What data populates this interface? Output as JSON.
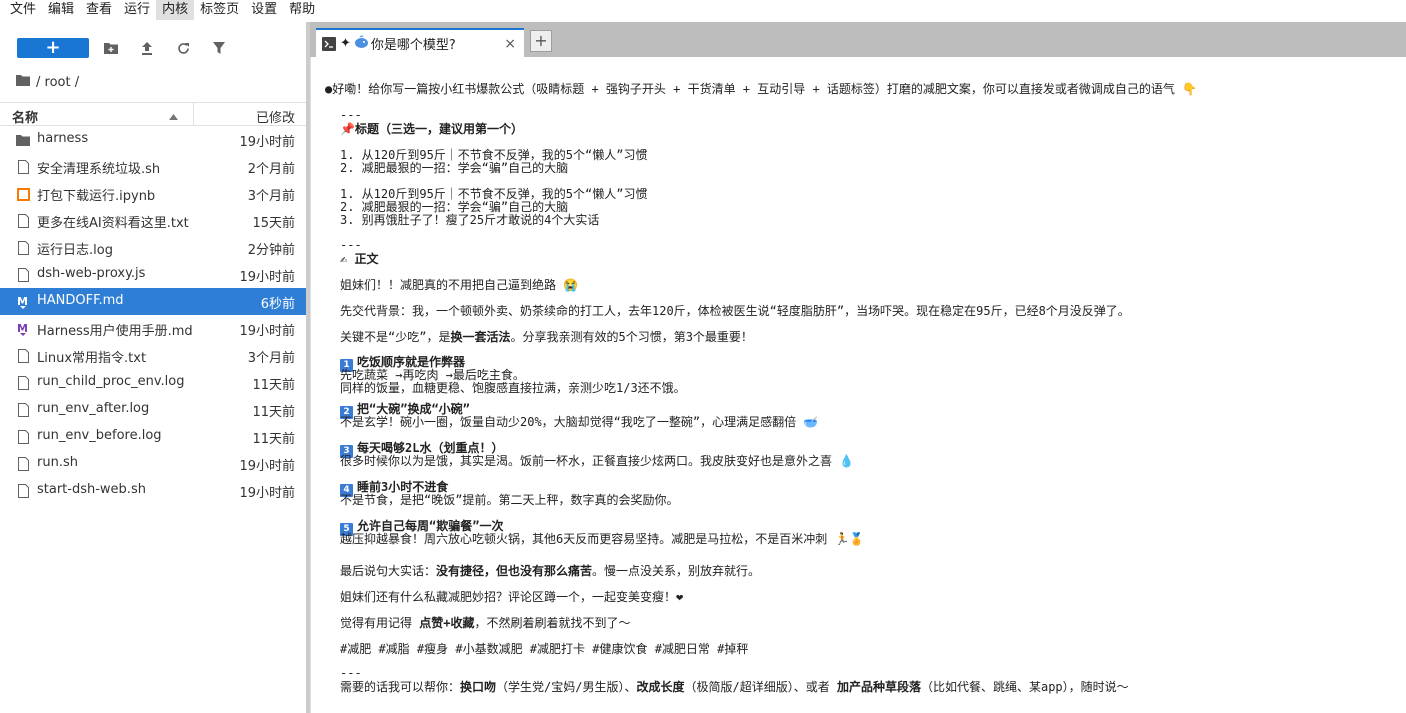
{
  "menu": [
    "文件",
    "编辑",
    "查看",
    "运行",
    "内核",
    "标签页",
    "设置",
    "帮助"
  ],
  "menu_active_index": 4,
  "filebrowser": {
    "new_label": "+",
    "breadcrumb": "/ root /",
    "col_name": "名称",
    "col_modified": "已修改",
    "files": [
      {
        "name": "harness",
        "modified": "19小时前",
        "icon": "folder-icon"
      },
      {
        "name": "安全清理系统垃圾.sh",
        "modified": "2个月前",
        "icon": "file-icon"
      },
      {
        "name": "打包下载运行.ipynb",
        "modified": "3个月前",
        "icon": "notebook-icon"
      },
      {
        "name": "更多在线AI资料看这里.txt",
        "modified": "15天前",
        "icon": "file-icon"
      },
      {
        "name": "运行日志.log",
        "modified": "2分钟前",
        "icon": "file-icon"
      },
      {
        "name": "dsh-web-proxy.js",
        "modified": "19小时前",
        "icon": "file-icon"
      },
      {
        "name": "HANDOFF.md",
        "modified": "6秒前",
        "icon": "markdown-icon",
        "selected": true
      },
      {
        "name": "Harness用户使用手册.md",
        "modified": "19小时前",
        "icon": "markdown-icon"
      },
      {
        "name": "Linux常用指令.txt",
        "modified": "3个月前",
        "icon": "file-icon"
      },
      {
        "name": "run_child_proc_env.log",
        "modified": "11天前",
        "icon": "file-icon"
      },
      {
        "name": "run_env_after.log",
        "modified": "11天前",
        "icon": "file-icon"
      },
      {
        "name": "run_env_before.log",
        "modified": "11天前",
        "icon": "file-icon"
      },
      {
        "name": "run.sh",
        "modified": "19小时前",
        "icon": "file-icon"
      },
      {
        "name": "start-dsh-web.sh",
        "modified": "19小时前",
        "icon": "file-icon"
      }
    ]
  },
  "tab": {
    "title": "你是哪个模型?",
    "close": "×",
    "add": "+"
  },
  "doc": {
    "intro": "●好嘞！给你写一篇按小红书爆款公式（吸睛标题 + 强钩子开头 + 干货清单 + 互动引导 + 话题标签）打磨的减肥文案，你可以直接发或者微调成自己的语气 👇",
    "hr1": "---",
    "title_head": "📌标题（三选一，建议用第一个）",
    "titles_a": [
      "1. 从120斤到95斤｜不节食不反弹，我的5个“懒人”习惯",
      "2. 减肥最狠的一招：学会“骗”自己的大脑"
    ],
    "titles_b": [
      "1. 从120斤到95斤｜不节食不反弹，我的5个“懒人”习惯",
      "2. 减肥最狠的一招：学会“骗”自己的大脑",
      "3. 别再饿肚子了！瘦了25斤才敢说的4个大实话"
    ],
    "hr2": "---",
    "body_head": "✍ 正文",
    "p1": "姐妹们！！减肥真的不用把自己逼到绝路 😭",
    "p2": "先交代背景：我，一个顿顿外卖、奶茶续命的打工人，去年120斤，体检被医生说“轻度脂肪肝”，当场吓哭。现在稳定在95斤，已经8个月没反弹了。",
    "p3_pre": "关键不是“少吃”，是",
    "p3_bold": "换一套活法",
    "p3_post": "。分享我亲测有效的5个习惯，第3个最重要！",
    "items": [
      {
        "num": "1",
        "head": "吃饭顺序就是作弊器",
        "lines": [
          "先吃蔬菜 →再吃肉 →最后吃主食。",
          "同样的饭量，血糖更稳、饱腹感直接拉满，亲测少吃1/3还不饿。"
        ]
      },
      {
        "num": "2",
        "head": "把“大碗”换成“小碗”",
        "lines": [
          "不是玄学！碗小一圈，饭量自动少20%，大脑却觉得“我吃了一整碗”，心理满足感翻倍 🥣"
        ]
      },
      {
        "num": "3",
        "head": "每天喝够2L水（划重点！）",
        "lines": [
          "很多时候你以为是饿，其实是渴。饭前一杯水，正餐直接少炫两口。我皮肤变好也是意外之喜 💧"
        ]
      },
      {
        "num": "4",
        "head": "睡前3小时不进食",
        "lines": [
          "不是节食，是把“晚饭”提前。第二天上秤，数字真的会奖励你。"
        ]
      },
      {
        "num": "5",
        "head": "允许自己每周“欺骗餐”一次",
        "lines": [
          "越压抑越暴食！周六放心吃顿火锅，其他6天反而更容易坚持。减肥是马拉松，不是百米冲刺 🏃🏅"
        ]
      }
    ],
    "p4_pre": "最后说句大实话：",
    "p4_bold": "没有捷径，但也没有那么痛苦",
    "p4_post": "。慢一点没关系，别放弃就行。",
    "p5": "姐妹们还有什么私藏减肥妙招？评论区蹲一个，一起变美变瘦！❤",
    "p6_pre": "觉得有用记得 ",
    "p6_bold": "点赞+收藏",
    "p6_post": "，不然刷着刷着就找不到了～",
    "tags": "#减肥 #减脂 #瘦身 #小基数减肥 #减肥打卡 #健康饮食 #减肥日常 #掉秤",
    "hr3": "---",
    "final_pre": "需要的话我可以帮你：",
    "final_b1": "换口吻",
    "final_m1": "（学生党/宝妈/男生版）、",
    "final_b2": "改成长度",
    "final_m2": "（极简版/超详细版）、或者 ",
    "final_b3": "加产品种草段落",
    "final_post": "（比如代餐、跳绳、某app），随时说～"
  },
  "colors": {
    "accent": "#1976d2",
    "selected_row": "#2e7ed6",
    "tabbar": "#bdbdbd"
  }
}
